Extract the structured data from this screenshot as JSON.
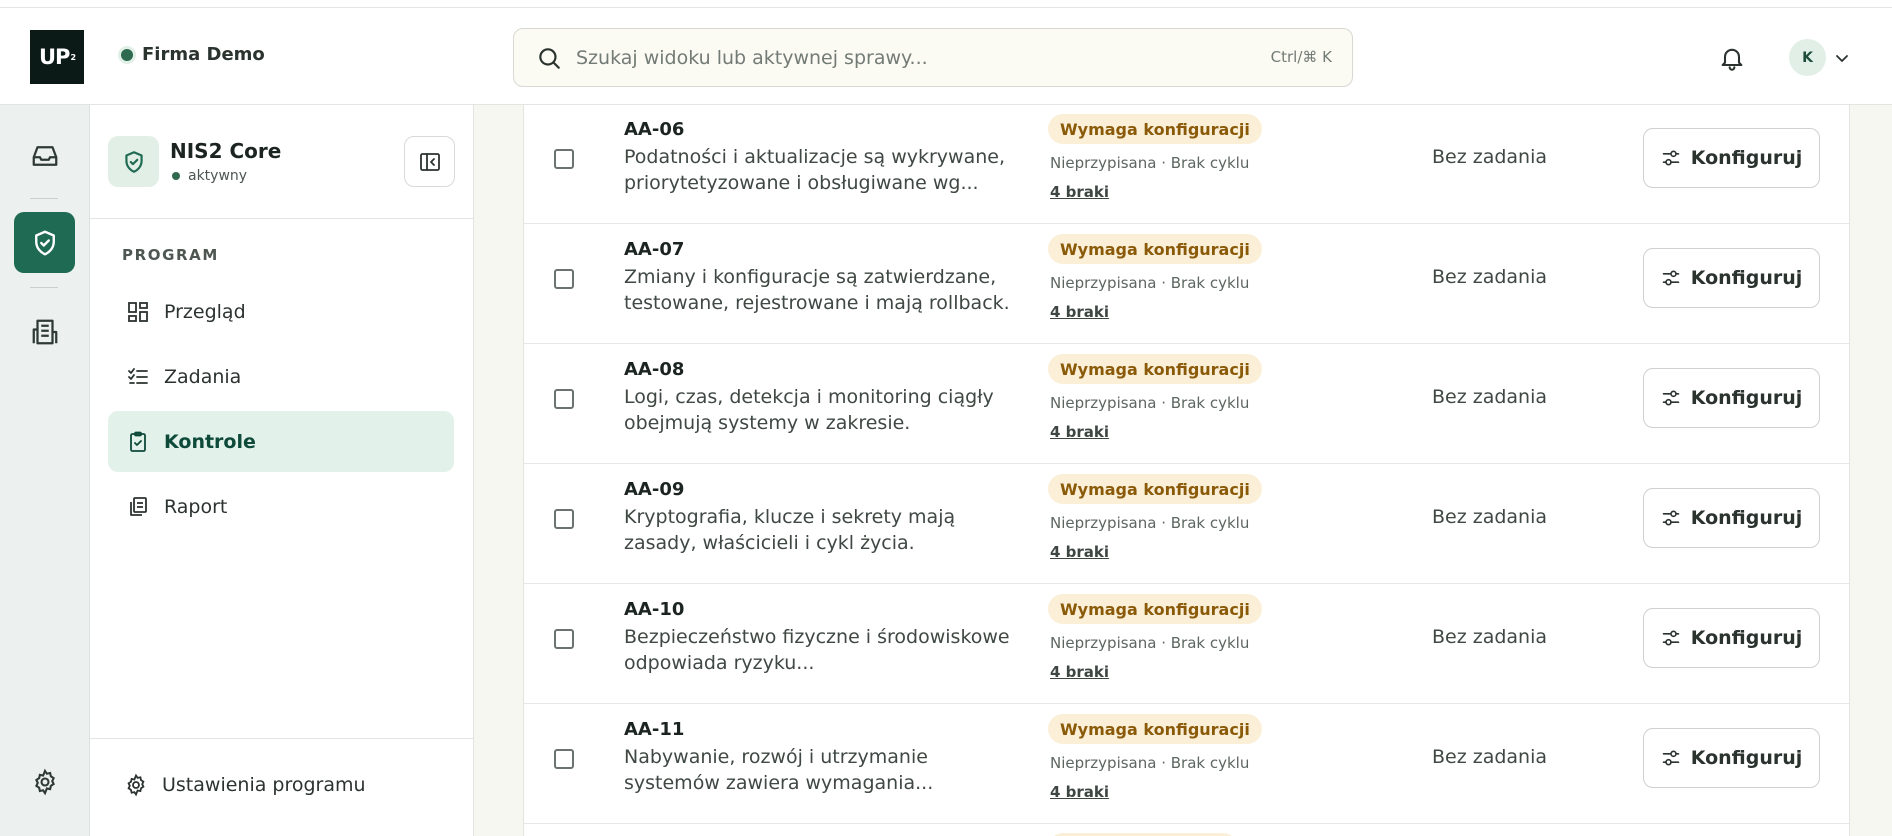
{
  "header": {
    "logo_text": "UP",
    "logo_sup": "2",
    "org_name": "Firma Demo",
    "search_placeholder": "Szukaj widoku lub aktywnej sprawy...",
    "search_shortcut": "Ctrl/⌘ K",
    "avatar_initial": "K"
  },
  "sidebar": {
    "program_name": "NIS2 Core",
    "program_status": "aktywny",
    "section_label": "PROGRAM",
    "nav": [
      {
        "label": "Przegląd",
        "icon": "dashboard-icon"
      },
      {
        "label": "Zadania",
        "icon": "checklist-icon"
      },
      {
        "label": "Kontrole",
        "icon": "clipboard-check-icon",
        "active": true
      },
      {
        "label": "Raport",
        "icon": "copy-report-icon"
      }
    ],
    "settings_label": "Ustawienia programu"
  },
  "controls": {
    "rows": [
      {
        "code": "AA-06",
        "desc": "Podatności i aktualizacje są wykrywane, priorytetyzowane i obsługiwane wg...",
        "status": "Wymaga konfiguracji",
        "meta": "Nieprzypisana · Brak cyklu",
        "gaps": "4 braki",
        "task": "Bez zadania",
        "action": "Konfiguruj"
      },
      {
        "code": "AA-07",
        "desc": "Zmiany i konfiguracje są zatwierdzane, testowane, rejestrowane i mają rollback.",
        "status": "Wymaga konfiguracji",
        "meta": "Nieprzypisana · Brak cyklu",
        "gaps": "4 braki",
        "task": "Bez zadania",
        "action": "Konfiguruj"
      },
      {
        "code": "AA-08",
        "desc": "Logi, czas, detekcja i monitoring ciągły obejmują systemy w zakresie.",
        "status": "Wymaga konfiguracji",
        "meta": "Nieprzypisana · Brak cyklu",
        "gaps": "4 braki",
        "task": "Bez zadania",
        "action": "Konfiguruj"
      },
      {
        "code": "AA-09",
        "desc": "Kryptografia, klucze i sekrety mają zasady, właścicieli i cykl życia.",
        "status": "Wymaga konfiguracji",
        "meta": "Nieprzypisana · Brak cyklu",
        "gaps": "4 braki",
        "task": "Bez zadania",
        "action": "Konfiguruj"
      },
      {
        "code": "AA-10",
        "desc": "Bezpieczeństwo fizyczne i środowiskowe odpowiada ryzyku...",
        "status": "Wymaga konfiguracji",
        "meta": "Nieprzypisana · Brak cyklu",
        "gaps": "4 braki",
        "task": "Bez zadania",
        "action": "Konfiguruj"
      },
      {
        "code": "AA-11",
        "desc": "Nabywanie, rozwój i utrzymanie systemów zawiera wymagania...",
        "status": "Wymaga konfiguracji",
        "meta": "Nieprzypisana · Brak cyklu",
        "gaps": "4 braki",
        "task": "Bez zadania",
        "action": "Konfiguruj"
      }
    ]
  },
  "colors": {
    "accent": "#1f6a53",
    "badge_bg": "#fbf0d7",
    "badge_text": "#8a5a08"
  }
}
